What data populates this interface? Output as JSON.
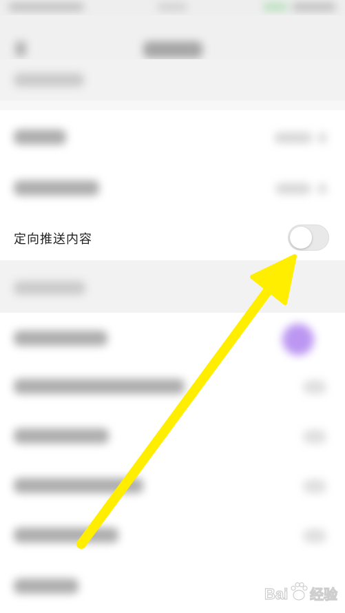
{
  "window_title": "",
  "setting_row": {
    "label": "定向推送内容",
    "toggle_state": "off"
  },
  "annotation": {
    "type": "arrow",
    "color": "#ffee00"
  },
  "watermark": {
    "text": "Bai 经验",
    "icon": "paw-icon"
  },
  "colors": {
    "background": "#f7f7f8",
    "toggle_off": "#e9e9ea",
    "arrow": "#ffee00",
    "accent_purple": "#b58cf0"
  }
}
